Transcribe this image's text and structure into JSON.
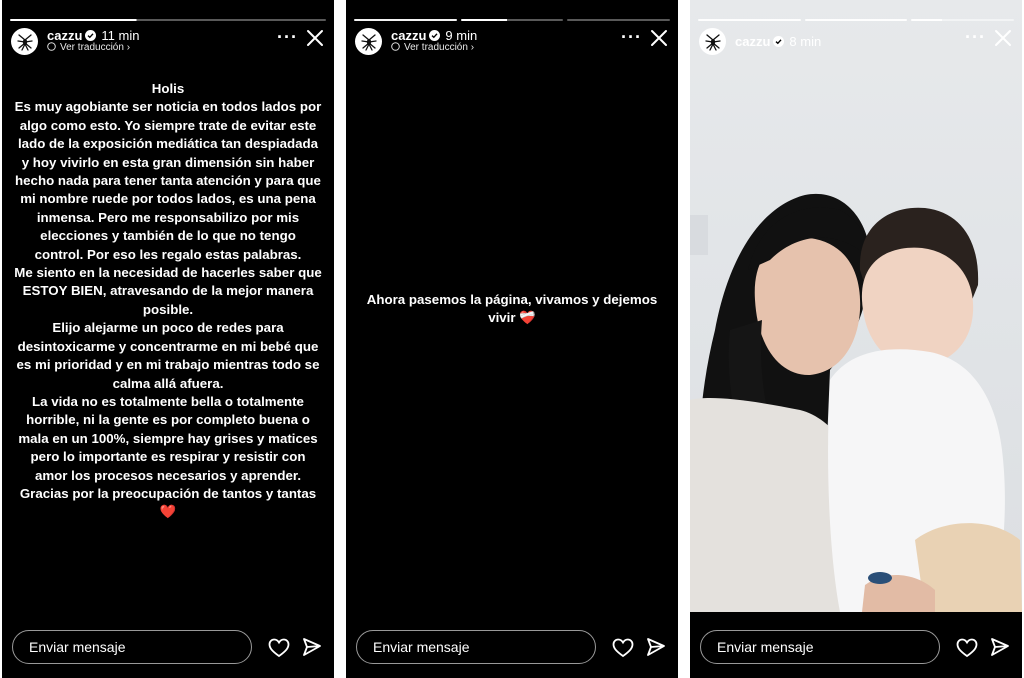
{
  "stories": [
    {
      "username": "cazzu",
      "time": "11 min",
      "translate_label": "Ver traducción",
      "paragraphs": [
        "Holis",
        "Es muy agobiante ser noticia en todos lados por algo como esto. Yo siempre trate de evitar este lado de la exposición mediática tan despiadada y hoy vivirlo en esta gran dimensión sin haber hecho nada para tener tanta atención y para que mi nombre ruede por todos lados, es una pena inmensa. Pero me responsabilizo por mis elecciones y también de lo que no tengo control. Por eso les regalo estas palabras.",
        "Me siento en la necesidad de hacerles saber que ESTOY BIEN, atravesando de la mejor manera posible.",
        "Elijo alejarme un poco de redes para desintoxicarme y concentrarme en mi bebé que es mi prioridad y en mi trabajo mientras todo se calma allá afuera.",
        "La vida no es totalmente bella o totalmente horrible, ni la gente es por completo buena o mala en un 100%, siempre hay grises y matices pero lo importante es respirar y resistir con amor los procesos necesarios y aprender.",
        "Gracias por la preocupación de tantos y tantas"
      ],
      "closing_emoji": "❤️",
      "message_placeholder": "Enviar mensaje"
    },
    {
      "username": "cazzu",
      "time": "9 min",
      "translate_label": "Ver traducción",
      "text": "Ahora pasemos la página, vivamos y dejemos vivir",
      "emoji": "❤️‍🩹",
      "message_placeholder": "Enviar mensaje"
    },
    {
      "username": "cazzu",
      "time": "8 min",
      "message_placeholder": "Enviar mensaje"
    }
  ],
  "colors": {
    "story_bg": "#000000",
    "text": "#ffffff",
    "heart": "#e8343c"
  },
  "icons": [
    "spider-avatar-icon",
    "verified-badge-icon",
    "more-options-icon",
    "close-icon",
    "heart-icon",
    "send-icon",
    "chevron-right-icon"
  ]
}
